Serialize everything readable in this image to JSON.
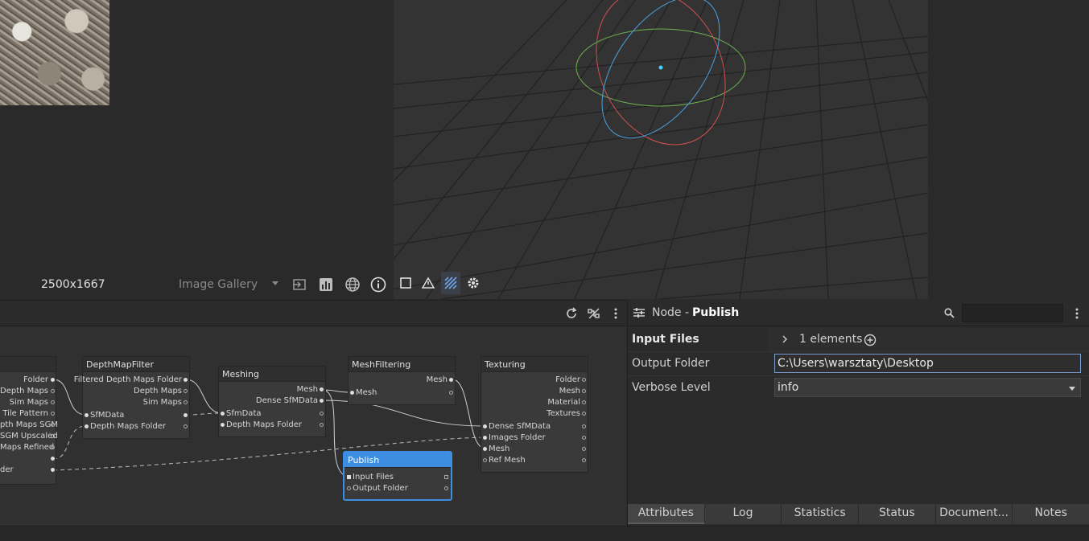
{
  "gallery": {
    "resolution": "2500x1667",
    "label": "Image Gallery"
  },
  "viewport": {
    "tools": [
      "square-icon",
      "warning-icon",
      "stripes-icon",
      "settings-icon"
    ]
  },
  "graph": {
    "nodes": {
      "left_partial": {
        "ports_out": [
          "Folder",
          "Depth Maps",
          "Sim Maps",
          "Tile Pattern",
          "pth Maps SGM",
          "SGM Upscaled",
          "Maps Refined",
          "",
          "der"
        ]
      },
      "depthmapfilter": {
        "title": "DepthMapFilter",
        "outputs": [
          "Filtered Depth Maps Folder",
          "Depth Maps",
          "Sim Maps"
        ],
        "inputs": [
          "SfMData",
          "Depth Maps Folder"
        ]
      },
      "meshing": {
        "title": "Meshing",
        "outputs": [
          "Mesh",
          "Dense SfMData"
        ],
        "inputs": [
          "SfmData",
          "Depth Maps Folder"
        ]
      },
      "meshfiltering": {
        "title": "MeshFiltering",
        "outputs": [
          "Mesh"
        ],
        "inputs": [
          "Mesh"
        ]
      },
      "texturing": {
        "title": "Texturing",
        "outputs": [
          "Folder",
          "Mesh",
          "Material",
          "Textures"
        ],
        "inputs": [
          "Dense SfMData",
          "Images Folder",
          "Mesh",
          "Ref Mesh"
        ]
      },
      "publish": {
        "title": "Publish",
        "inputs": [
          "Input Files",
          "Output Folder"
        ]
      }
    }
  },
  "panel": {
    "title_prefix": "Node -",
    "title_node": "Publish",
    "attributes": {
      "input_files_label": "Input Files",
      "input_files_value": "1 elements",
      "output_folder_label": "Output Folder",
      "output_folder_value": "C:\\Users\\warsztaty\\Desktop",
      "verbose_label": "Verbose Level",
      "verbose_value": "info"
    },
    "tabs": [
      "Attributes",
      "Log",
      "Statistics",
      "Status",
      "Document...",
      "Notes"
    ],
    "active_tab": "Attributes"
  },
  "colors": {
    "accent": "#3d8ee0",
    "gizmo_red": "#d05050",
    "gizmo_green": "#70b050",
    "gizmo_blue": "#4aa0e0"
  }
}
